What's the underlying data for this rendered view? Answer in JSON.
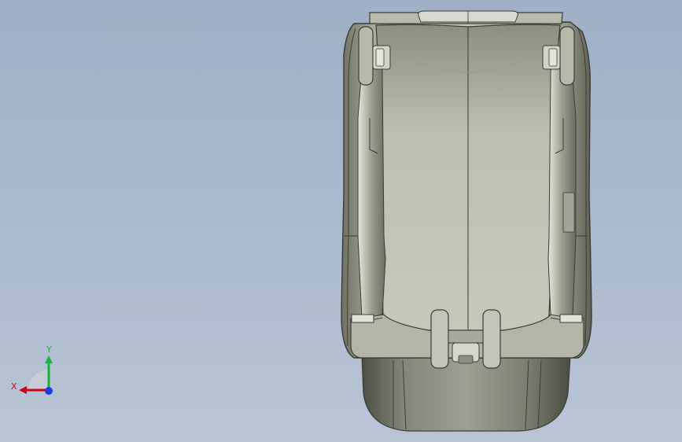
{
  "viewport": {
    "background_top": "#9fb0c6",
    "background_bottom": "#b9c5d6"
  },
  "model": {
    "name": "",
    "view": "top"
  },
  "triad": {
    "x_label": "X",
    "y_label": "Y",
    "x_color": "#d0021b",
    "y_color": "#18b33a",
    "z_color": "#1f3fd8"
  }
}
